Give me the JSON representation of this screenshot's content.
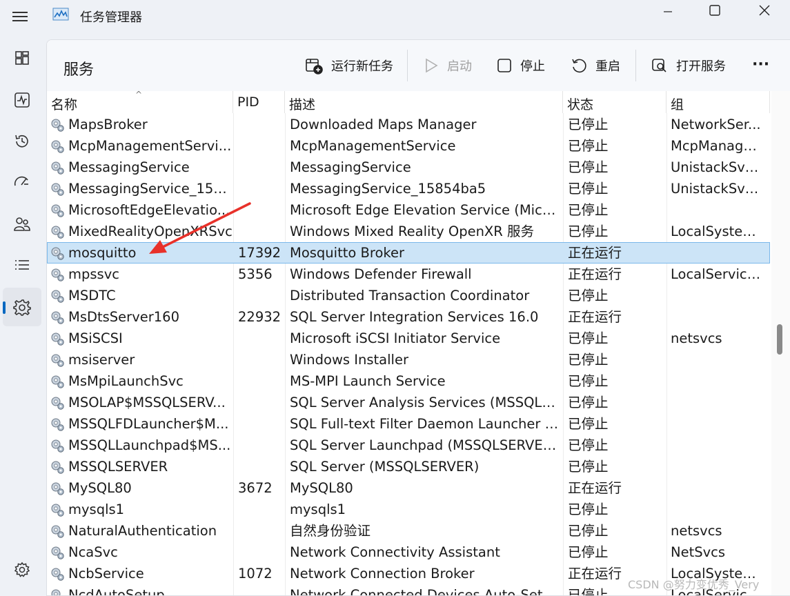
{
  "window": {
    "title": "任务管理器",
    "minimize_label": "minimize",
    "maximize_label": "maximize",
    "close_label": "close"
  },
  "nav": {
    "items": [
      {
        "name": "processes",
        "icon": "grid-icon"
      },
      {
        "name": "performance",
        "icon": "pulse-icon"
      },
      {
        "name": "app-history",
        "icon": "history-icon"
      },
      {
        "name": "startup-apps",
        "icon": "speedometer-icon"
      },
      {
        "name": "users",
        "icon": "users-icon"
      },
      {
        "name": "details",
        "icon": "list-icon"
      },
      {
        "name": "services",
        "icon": "puzzle-icon",
        "active": true
      }
    ],
    "settings_icon": "gear-icon"
  },
  "toolbar": {
    "title": "服务",
    "run_new_task": "运行新任务",
    "start": "启动",
    "stop": "停止",
    "restart": "重启",
    "open_services": "打开服务",
    "more": "···"
  },
  "table": {
    "columns": [
      "名称",
      "PID",
      "描述",
      "状态",
      "组"
    ],
    "rows": [
      {
        "name": "MapsBroker",
        "pid": "",
        "desc": "Downloaded Maps Manager",
        "status": "已停止",
        "group": "NetworkSer..."
      },
      {
        "name": "McpManagementServi...",
        "pid": "",
        "desc": "McpManagementService",
        "status": "已停止",
        "group": "McpManage..."
      },
      {
        "name": "MessagingService",
        "pid": "",
        "desc": "MessagingService",
        "status": "已停止",
        "group": "UnistackSvc..."
      },
      {
        "name": "MessagingService_158...",
        "pid": "",
        "desc": "MessagingService_15854ba5",
        "status": "已停止",
        "group": "UnistackSvc..."
      },
      {
        "name": "MicrosoftEdgeElevatio...",
        "pid": "",
        "desc": "Microsoft Edge Elevation Service (Micr...",
        "status": "已停止",
        "group": ""
      },
      {
        "name": "MixedRealityOpenXRSvc",
        "pid": "",
        "desc": "Windows Mixed Reality OpenXR 服务",
        "status": "已停止",
        "group": "LocalSystem..."
      },
      {
        "name": "mosquitto",
        "pid": "17392",
        "desc": "Mosquitto Broker",
        "status": "正在运行",
        "group": "",
        "selected": true
      },
      {
        "name": "mpssvc",
        "pid": "5356",
        "desc": "Windows Defender Firewall",
        "status": "正在运行",
        "group": "LocalService..."
      },
      {
        "name": "MSDTC",
        "pid": "",
        "desc": "Distributed Transaction Coordinator",
        "status": "已停止",
        "group": ""
      },
      {
        "name": "MsDtsServer160",
        "pid": "22932",
        "desc": "SQL Server Integration Services 16.0",
        "status": "正在运行",
        "group": ""
      },
      {
        "name": "MSiSCSI",
        "pid": "",
        "desc": "Microsoft iSCSI Initiator Service",
        "status": "已停止",
        "group": "netsvcs"
      },
      {
        "name": "msiserver",
        "pid": "",
        "desc": "Windows Installer",
        "status": "已停止",
        "group": ""
      },
      {
        "name": "MsMpiLaunchSvc",
        "pid": "",
        "desc": "MS-MPI Launch Service",
        "status": "已停止",
        "group": ""
      },
      {
        "name": "MSOLAP$MSSQLSERV...",
        "pid": "",
        "desc": "SQL Server Analysis Services (MSSQLS...",
        "status": "已停止",
        "group": ""
      },
      {
        "name": "MSSQLFDLauncher$M...",
        "pid": "",
        "desc": "SQL Full-text Filter Daemon Launcher (...",
        "status": "已停止",
        "group": ""
      },
      {
        "name": "MSSQLLaunchpad$MS...",
        "pid": "",
        "desc": "SQL Server Launchpad (MSSQLSERVER...",
        "status": "已停止",
        "group": ""
      },
      {
        "name": "MSSQLSERVER",
        "pid": "",
        "desc": "SQL Server (MSSQLSERVER)",
        "status": "已停止",
        "group": ""
      },
      {
        "name": "MySQL80",
        "pid": "3672",
        "desc": "MySQL80",
        "status": "正在运行",
        "group": ""
      },
      {
        "name": "mysqls1",
        "pid": "",
        "desc": "mysqls1",
        "status": "已停止",
        "group": ""
      },
      {
        "name": "NaturalAuthentication",
        "pid": "",
        "desc": "自然身份验证",
        "status": "已停止",
        "group": "netsvcs"
      },
      {
        "name": "NcaSvc",
        "pid": "",
        "desc": "Network Connectivity Assistant",
        "status": "已停止",
        "group": "NetSvcs"
      },
      {
        "name": "NcbService",
        "pid": "1072",
        "desc": "Network Connection Broker",
        "status": "正在运行",
        "group": "LocalSystem..."
      },
      {
        "name": "NcdAutoSetup",
        "pid": "",
        "desc": "Network Connected Devices Auto-Setup",
        "status": "已停止",
        "group": "LocalService..."
      }
    ]
  },
  "watermark": "CSDN @努力变优秀_Very",
  "colors": {
    "accent": "#0067c0",
    "selected_row": "#cce4f7",
    "annotation_arrow": "#e8312a"
  }
}
